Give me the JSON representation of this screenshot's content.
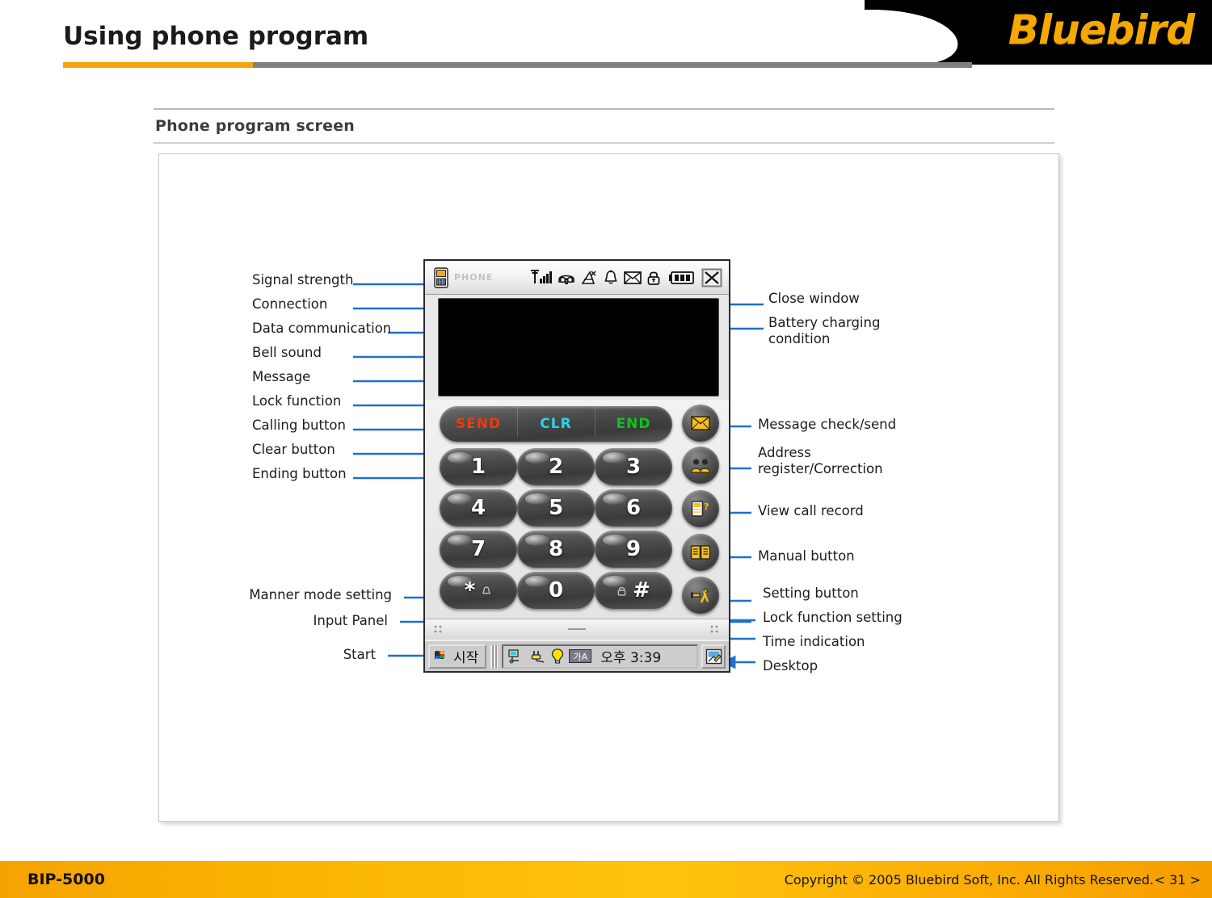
{
  "header": {
    "title": "Using phone program",
    "brand": "Bluebird",
    "accent_orange": "#F7A30B",
    "accent_gray": "#808080",
    "logo_color": "#F5A800"
  },
  "section": {
    "title": "Phone program screen"
  },
  "callouts_left": [
    {
      "label": "Signal strength",
      "name": "callout-signal-strength"
    },
    {
      "label": "Connection",
      "name": "callout-connection"
    },
    {
      "label": "Data communication",
      "name": "callout-data-communication"
    },
    {
      "label": "Bell sound",
      "name": "callout-bell-sound"
    },
    {
      "label": "Message",
      "name": "callout-message"
    },
    {
      "label": "Lock function",
      "name": "callout-lock-function"
    },
    {
      "label": "Calling button",
      "name": "callout-calling-button"
    },
    {
      "label": "Clear button",
      "name": "callout-clear-button"
    },
    {
      "label": "Ending button",
      "name": "callout-ending-button"
    },
    {
      "label": "Manner mode setting",
      "name": "callout-manner-mode-setting"
    },
    {
      "label": "Input Panel",
      "name": "callout-input-panel"
    },
    {
      "label": "Start",
      "name": "callout-start"
    }
  ],
  "callouts_right": [
    {
      "label": "Close window",
      "name": "callout-close-window"
    },
    {
      "label": "Battery charging\ncondition",
      "name": "callout-battery-charging-condition"
    },
    {
      "label": "Message check/send",
      "name": "callout-message-check-send"
    },
    {
      "label": "Address\nregister/Correction",
      "name": "callout-address-register-correction"
    },
    {
      "label": "View call record",
      "name": "callout-view-call-record"
    },
    {
      "label": "Manual button",
      "name": "callout-manual-button"
    },
    {
      "label": "Setting button",
      "name": "callout-setting-button"
    },
    {
      "label": "Lock function setting",
      "name": "callout-lock-function-setting"
    },
    {
      "label": "Time indication",
      "name": "callout-time-indication"
    },
    {
      "label": "Desktop",
      "name": "callout-desktop"
    }
  ],
  "device": {
    "titlebar": {
      "app_label": "PHONE",
      "icons": [
        "phone-app-icon",
        "signal-strength-icon",
        "connection-icon",
        "data-communication-icon",
        "bell-sound-icon",
        "message-icon",
        "lock-icon",
        "battery-icon",
        "close-window-icon"
      ],
      "battery_bars": 3,
      "signal_bars": 4
    },
    "function_keys": [
      {
        "label": "SEND",
        "color": "#F03C0A",
        "name": "send-key"
      },
      {
        "label": "CLR",
        "color": "#28D6F0",
        "name": "clear-key"
      },
      {
        "label": "END",
        "color": "#11C21B",
        "name": "end-key"
      }
    ],
    "keypad": [
      [
        "1",
        "2",
        "3"
      ],
      [
        "4",
        "5",
        "6"
      ],
      [
        "7",
        "8",
        "9"
      ],
      [
        "*",
        "0",
        "#"
      ]
    ],
    "key_badges": {
      "star": "manner-mode-bell-icon",
      "hash": "lock-icon"
    },
    "side_buttons": [
      {
        "icon": "envelope-icon",
        "name": "message-check-send-button"
      },
      {
        "icon": "contacts-icon",
        "name": "address-register-button"
      },
      {
        "icon": "call-record-icon",
        "name": "view-call-record-button"
      },
      {
        "icon": "manual-book-icon",
        "name": "manual-button"
      },
      {
        "icon": "tools-icon",
        "name": "setting-button"
      }
    ],
    "taskbar": {
      "start_label": "시작",
      "time": "오후 3:39",
      "tray_icons": [
        "network-icon",
        "power-plug-icon",
        "light-bulb-icon",
        "ime-indicator-icon"
      ],
      "ime_label": "가A",
      "desktop_icon": "desktop-icon"
    }
  },
  "footer": {
    "model": "BIP-5000",
    "copyright": "Copyright © 2005 Bluebird Soft, Inc. All Rights Reserved.",
    "page": "< 31 >",
    "background": "#FFC20E"
  }
}
